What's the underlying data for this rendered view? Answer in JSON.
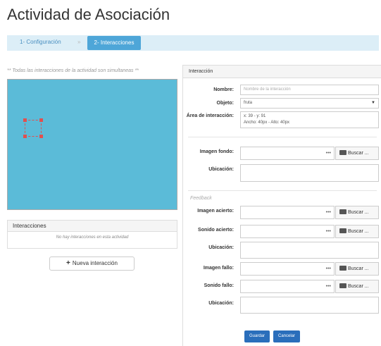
{
  "page": {
    "title": "Actividad de Asociación"
  },
  "wizard": {
    "step1": "1- Configuración",
    "separator": "»",
    "step2": "2- Interacciones"
  },
  "note": "** Todas las interacciones de la actividad son simultaneas **",
  "interactions_panel": {
    "title": "Interacciones",
    "empty": "No hay interacciones en esta actividad"
  },
  "new_interaction_button": {
    "plus": "+",
    "label": "Nueva interacción"
  },
  "form": {
    "title": "Interacción",
    "nombre": {
      "label": "Nombre:",
      "placeholder": "Nombre de la interacción"
    },
    "objeto": {
      "label": "Objeto:",
      "value": "fruta"
    },
    "area": {
      "label": "Área de interacción:",
      "line1": "x: 39 - y: 91",
      "line2": "Ancho: 40px - Alto: 40px"
    },
    "imagen_fondo": {
      "label": "Imagen fondo:"
    },
    "ubicacion1": {
      "label": "Ubicación:"
    },
    "feedback": "Feedback",
    "imagen_acierto": {
      "label": "Imagen acierto:"
    },
    "sonido_acierto": {
      "label": "Sonido acierto:"
    },
    "ubicacion2": {
      "label": "Ubicación:"
    },
    "imagen_fallo": {
      "label": "Imagen fallo:"
    },
    "sonido_fallo": {
      "label": "Sonido fallo:"
    },
    "ubicacion3": {
      "label": "Ubicación:"
    },
    "dots": "•••",
    "buscar": "Buscar ...",
    "guardar": "Guardar",
    "cancelar": "Cancelar"
  },
  "colors": {
    "canvas": "#5bbbd8",
    "accent": "#4ea6d8",
    "primary_button": "#2a6ebb",
    "selection": "#e05050"
  }
}
